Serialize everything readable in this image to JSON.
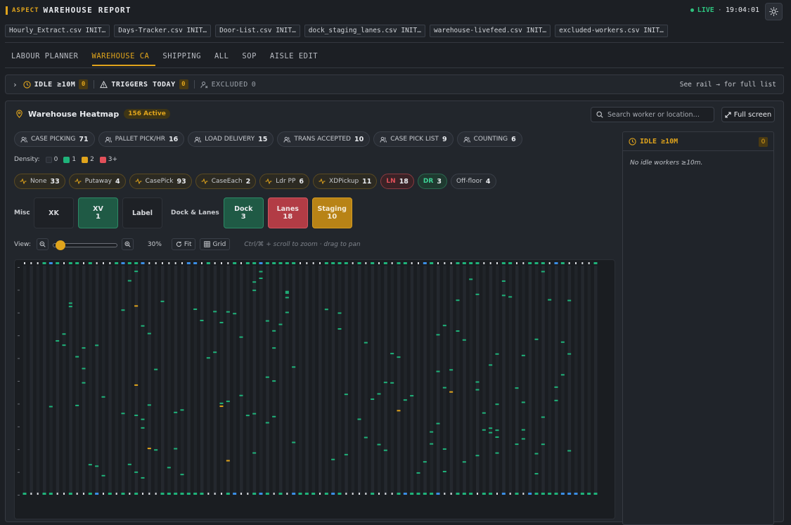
{
  "brand": {
    "aspect": "ASPECT",
    "title": "WAREHOUSE REPORT"
  },
  "status": {
    "live": "LIVE",
    "sep": "·",
    "time": "19:04:01"
  },
  "files": [
    "Hourly_Extract.csv INIT…",
    "Days-Tracker.csv INIT…",
    "Door-List.csv INIT…",
    "dock_staging_lanes.csv INIT…",
    "warehouse-livefeed.csv INIT…",
    "excluded-workers.csv INIT…"
  ],
  "tabs": [
    {
      "label": "LABOUR PLANNER",
      "active": false
    },
    {
      "label": "WAREHOUSE CA",
      "active": true
    },
    {
      "label": "SHIPPING",
      "active": false
    },
    {
      "label": "ALL",
      "active": false
    },
    {
      "label": "SOP",
      "active": false
    },
    {
      "label": "AISLE EDIT",
      "active": false
    }
  ],
  "alerts": {
    "expand": "›",
    "idle_label": "IDLE ≥10M",
    "idle_count": "0",
    "triggers_label": "TRIGGERS TODAY",
    "triggers_count": "0",
    "excluded_label": "EXCLUDED",
    "excluded_count": "0",
    "hint": "See rail → for full list"
  },
  "heatmap": {
    "title": "Warehouse Heatmap",
    "active_badge": "156 Active",
    "search_placeholder": "Search worker or location…",
    "fullscreen": "Full screen",
    "tasks": [
      {
        "label": "CASE PICKING",
        "count": "71"
      },
      {
        "label": "PALLET PICK/HR",
        "count": "16"
      },
      {
        "label": "LOAD DELIVERY",
        "count": "15"
      },
      {
        "label": "TRANS ACCEPTED",
        "count": "10"
      },
      {
        "label": "CASE PICK LIST",
        "count": "9"
      },
      {
        "label": "COUNTING",
        "count": "6"
      }
    ],
    "density": {
      "label": "Density:",
      "levels": [
        {
          "label": "0",
          "color": "#2a2e35"
        },
        {
          "label": "1",
          "color": "#1fb37a"
        },
        {
          "label": "2",
          "color": "#e0a41c"
        },
        {
          "label": "3+",
          "color": "#e2505a"
        }
      ]
    },
    "categories": [
      {
        "label": "None",
        "count": "33",
        "kind": "normal"
      },
      {
        "label": "Putaway",
        "count": "4",
        "kind": "normal"
      },
      {
        "label": "CasePick",
        "count": "93",
        "kind": "normal"
      },
      {
        "label": "CaseEach",
        "count": "2",
        "kind": "normal"
      },
      {
        "label": "Ldr PP",
        "count": "6",
        "kind": "normal"
      },
      {
        "label": "XDPickup",
        "count": "11",
        "kind": "normal"
      },
      {
        "label": "LN",
        "count": "18",
        "kind": "ln"
      },
      {
        "label": "DR",
        "count": "3",
        "kind": "dr"
      },
      {
        "label": "Off-floor",
        "count": "4",
        "kind": "off"
      }
    ],
    "misc_label": "Misc",
    "dock_label": "Dock & Lanes",
    "misc_zones": [
      {
        "label": "XK",
        "count": "",
        "style": "neutral"
      },
      {
        "label": "XV",
        "count": "1",
        "style": "green"
      },
      {
        "label": "Label",
        "count": "",
        "style": "neutral"
      }
    ],
    "dock_zones": [
      {
        "label": "Dock",
        "count": "3",
        "style": "green"
      },
      {
        "label": "Lanes",
        "count": "18",
        "style": "red"
      },
      {
        "label": "Staging",
        "count": "10",
        "style": "amber"
      }
    ],
    "view": {
      "label": "View:",
      "zoom": "30%",
      "zoom_fraction": 0.05,
      "fit": "Fit",
      "grid": "Grid",
      "hint": "Ctrl/⌘ + scroll to zoom · drag to pan"
    }
  },
  "rail": {
    "title": "IDLE ≥10M",
    "count": "0",
    "empty": "No idle workers ≥10m."
  },
  "colors": {
    "accent": "#e0a41c",
    "green": "#1fb37a",
    "red": "#e2505a",
    "blue": "#3a8ee6"
  }
}
